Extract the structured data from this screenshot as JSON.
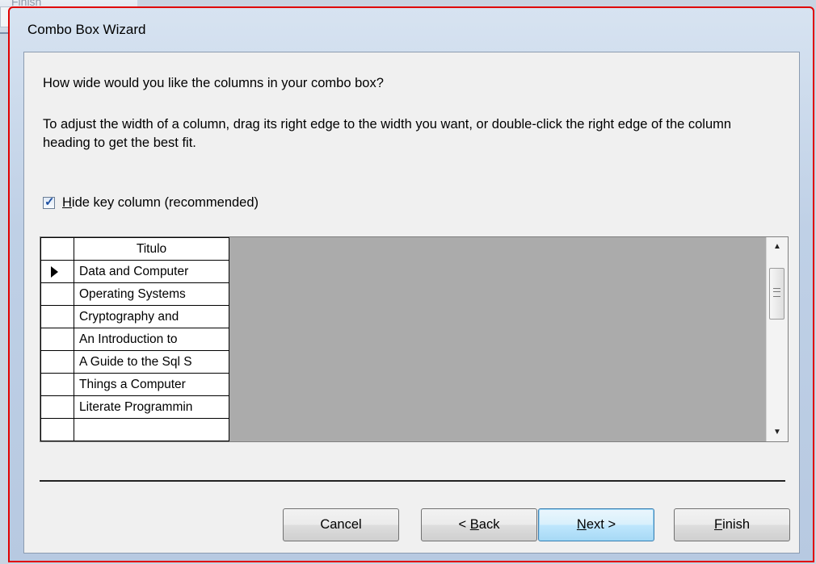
{
  "background_window": {
    "partial_label": "Finish"
  },
  "dialog": {
    "title": "Combo Box Wizard",
    "question": "How wide would you like the columns in your combo box?",
    "instructions": "To adjust the width of a column, drag its right edge to the width you want, or double-click the right edge of the column heading to get the best fit.",
    "hide_key": {
      "checked": true,
      "mnemonic": "H",
      "label_rest": "ide key column (recommended)"
    },
    "grid": {
      "column_header": "Titulo",
      "rows": [
        "Data and Computer",
        "Operating Systems",
        "Cryptography and",
        "An Introduction to",
        "A Guide to the Sql S",
        "Things a Computer",
        "Literate Programmin"
      ],
      "selected_row": 0
    },
    "buttons": {
      "cancel": "Cancel",
      "back_prefix": "< ",
      "back_mnemonic": "B",
      "back_rest": "ack",
      "next_mnemonic": "N",
      "next_rest": "ext >",
      "finish_mnemonic": "F",
      "finish_rest": "inish"
    }
  },
  "icons": {
    "row_selector": "row-pointer-icon",
    "checkbox": "checkmark-icon",
    "scroll_up": "chevron-up-icon",
    "scroll_down": "chevron-down-icon"
  },
  "colors": {
    "highlight_border": "#e00000",
    "grid_background": "#ababab",
    "default_button_border": "#3c7fb1"
  }
}
